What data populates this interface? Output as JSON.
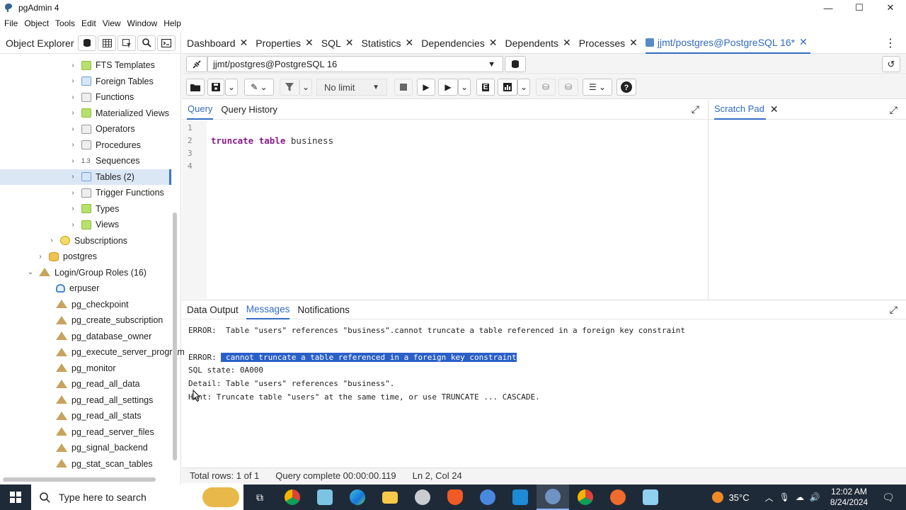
{
  "window": {
    "title": "pgAdmin 4",
    "controls": [
      "—",
      "☐",
      "✕"
    ]
  },
  "menu": [
    "File",
    "Object",
    "Tools",
    "Edit",
    "View",
    "Window",
    "Help"
  ],
  "object_explorer": {
    "label": "Object Explorer",
    "tree": [
      {
        "label": "FTS Templates",
        "indent": 3,
        "icon": "green"
      },
      {
        "label": "Foreign Tables",
        "indent": 3,
        "icon": "blue"
      },
      {
        "label": "Functions",
        "indent": 3,
        "icon": "gray"
      },
      {
        "label": "Materialized Views",
        "indent": 3,
        "icon": "green"
      },
      {
        "label": "Operators",
        "indent": 3,
        "icon": "gray"
      },
      {
        "label": "Procedures",
        "indent": 3,
        "icon": "gray"
      },
      {
        "label": "Sequences",
        "indent": 3,
        "icon": "seq"
      },
      {
        "label": "Tables (2)",
        "indent": 3,
        "icon": "blue",
        "selected": true
      },
      {
        "label": "Trigger Functions",
        "indent": 3,
        "icon": "gray"
      },
      {
        "label": "Types",
        "indent": 3,
        "icon": "green"
      },
      {
        "label": "Views",
        "indent": 3,
        "icon": "green"
      },
      {
        "label": "Subscriptions",
        "indent": 2,
        "icon": "sub"
      },
      {
        "label": "postgres",
        "indent": 1,
        "icon": "db"
      },
      {
        "label": "Login/Group Roles (16)",
        "indent": 0,
        "icon": "role",
        "expanded": true
      },
      {
        "label": "erpuser",
        "indent": 1,
        "icon": "user",
        "leaf": true
      },
      {
        "label": "pg_checkpoint",
        "indent": 1,
        "icon": "role",
        "leaf": true
      },
      {
        "label": "pg_create_subscription",
        "indent": 1,
        "icon": "role",
        "leaf": true
      },
      {
        "label": "pg_database_owner",
        "indent": 1,
        "icon": "role",
        "leaf": true
      },
      {
        "label": "pg_execute_server_program",
        "indent": 1,
        "icon": "role",
        "leaf": true
      },
      {
        "label": "pg_monitor",
        "indent": 1,
        "icon": "role",
        "leaf": true
      },
      {
        "label": "pg_read_all_data",
        "indent": 1,
        "icon": "role",
        "leaf": true
      },
      {
        "label": "pg_read_all_settings",
        "indent": 1,
        "icon": "role",
        "leaf": true
      },
      {
        "label": "pg_read_all_stats",
        "indent": 1,
        "icon": "role",
        "leaf": true
      },
      {
        "label": "pg_read_server_files",
        "indent": 1,
        "icon": "role",
        "leaf": true
      },
      {
        "label": "pg_signal_backend",
        "indent": 1,
        "icon": "role",
        "leaf": true
      },
      {
        "label": "pg_stat_scan_tables",
        "indent": 1,
        "icon": "role",
        "leaf": true
      }
    ]
  },
  "tabs": [
    "Dashboard",
    "Properties",
    "SQL",
    "Statistics",
    "Dependencies",
    "Dependents",
    "Processes"
  ],
  "active_tab": "jjmt/postgres@PostgreSQL 16*",
  "connection": "jjmt/postgres@PostgreSQL 16",
  "toolbar": {
    "limit": "No limit"
  },
  "query_tabs": [
    "Query",
    "Query History"
  ],
  "editor": {
    "line_numbers": [
      "1",
      "2",
      "3",
      "4"
    ],
    "lines": [
      "",
      "truncate table business",
      "",
      ""
    ]
  },
  "scratch_pad": {
    "label": "Scratch Pad"
  },
  "output_tabs": [
    "Data Output",
    "Messages",
    "Notifications"
  ],
  "messages": {
    "line1": "ERROR:  Table \"users\" references \"business\".cannot truncate a table referenced in a foreign key constraint",
    "line2_prefix": "ERROR: ",
    "line2_highlight": " cannot truncate a table referenced in a foreign key constraint",
    "line3": "SQL state: 0A000",
    "line4": "Detail: Table \"users\" references \"business\".",
    "line5": "Hint: Truncate table \"users\" at the same time, or use TRUNCATE ... CASCADE."
  },
  "status": {
    "rows": "Total rows: 1 of 1",
    "query": "Query complete 00:00:00.119",
    "position": "Ln 2, Col 24"
  },
  "taskbar": {
    "search_placeholder": "Type here to search",
    "temperature": "35°C",
    "time": "12:02 AM",
    "date": "8/24/2024"
  },
  "colors": {
    "accent": "#326bc2",
    "highlight": "#2a5fc7",
    "taskbar": "#1f2a38"
  }
}
